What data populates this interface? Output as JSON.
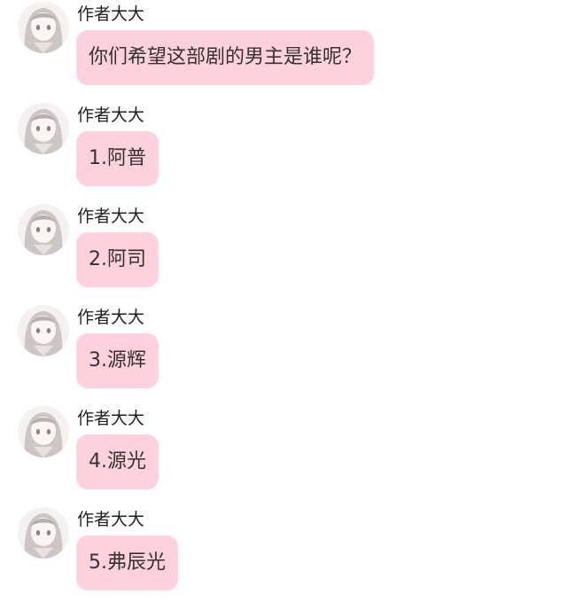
{
  "colors": {
    "bubble": "#ffd1dc",
    "background": "#ffffff",
    "text": "#333333"
  },
  "messages": [
    {
      "sender": "作者大大",
      "avatar_icon": "anime-girl-avatar",
      "text": "你们希望这部剧的男主是谁呢？"
    },
    {
      "sender": "作者大大",
      "avatar_icon": "anime-girl-avatar",
      "text": "1.阿普"
    },
    {
      "sender": "作者大大",
      "avatar_icon": "anime-girl-avatar",
      "text": "2.阿司"
    },
    {
      "sender": "作者大大",
      "avatar_icon": "anime-girl-avatar",
      "text": "3.源辉"
    },
    {
      "sender": "作者大大",
      "avatar_icon": "anime-girl-avatar",
      "text": "4.源光"
    },
    {
      "sender": "作者大大",
      "avatar_icon": "anime-girl-avatar",
      "text": "5.弗辰光"
    }
  ]
}
